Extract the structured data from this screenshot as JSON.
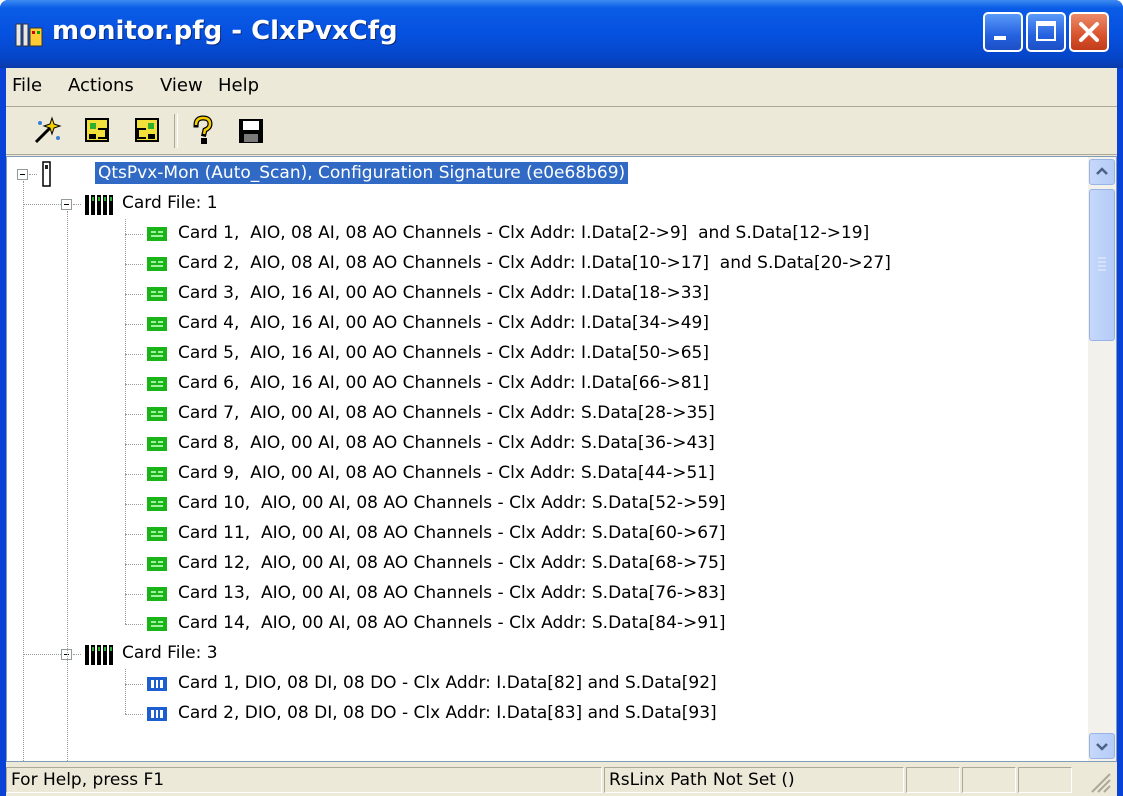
{
  "window": {
    "title": "monitor.pfg - ClxPvxCfg"
  },
  "menu": [
    {
      "label": "File"
    },
    {
      "label": "Actions"
    },
    {
      "label": "View"
    },
    {
      "label": "Help"
    }
  ],
  "toolbar": [
    {
      "name": "wizard-tool-icon"
    },
    {
      "name": "download-tool-icon"
    },
    {
      "name": "upload-tool-icon"
    },
    {
      "name": "help-tool-icon"
    },
    {
      "name": "save-tool-icon"
    }
  ],
  "tree": {
    "root": {
      "label": "QtsPvx-Mon (Auto_Scan), Configuration Signature (e0e68b69)",
      "selected": true
    },
    "card_files": [
      {
        "label": "Card File: 1",
        "cards": [
          {
            "label": "Card 1,  AIO, 08 AI, 08 AO Channels - Clx Addr: I.Data[2->9]  and S.Data[12->19]",
            "type": "aio"
          },
          {
            "label": "Card 2,  AIO, 08 AI, 08 AO Channels - Clx Addr: I.Data[10->17]  and S.Data[20->27]",
            "type": "aio"
          },
          {
            "label": "Card 3,  AIO, 16 AI, 00 AO Channels - Clx Addr: I.Data[18->33]",
            "type": "aio"
          },
          {
            "label": "Card 4,  AIO, 16 AI, 00 AO Channels - Clx Addr: I.Data[34->49]",
            "type": "aio"
          },
          {
            "label": "Card 5,  AIO, 16 AI, 00 AO Channels - Clx Addr: I.Data[50->65]",
            "type": "aio"
          },
          {
            "label": "Card 6,  AIO, 16 AI, 00 AO Channels - Clx Addr: I.Data[66->81]",
            "type": "aio"
          },
          {
            "label": "Card 7,  AIO, 00 AI, 08 AO Channels - Clx Addr: S.Data[28->35]",
            "type": "aio"
          },
          {
            "label": "Card 8,  AIO, 00 AI, 08 AO Channels - Clx Addr: S.Data[36->43]",
            "type": "aio"
          },
          {
            "label": "Card 9,  AIO, 00 AI, 08 AO Channels - Clx Addr: S.Data[44->51]",
            "type": "aio"
          },
          {
            "label": "Card 10,  AIO, 00 AI, 08 AO Channels - Clx Addr: S.Data[52->59]",
            "type": "aio"
          },
          {
            "label": "Card 11,  AIO, 00 AI, 08 AO Channels - Clx Addr: S.Data[60->67]",
            "type": "aio"
          },
          {
            "label": "Card 12,  AIO, 00 AI, 08 AO Channels - Clx Addr: S.Data[68->75]",
            "type": "aio"
          },
          {
            "label": "Card 13,  AIO, 00 AI, 08 AO Channels - Clx Addr: S.Data[76->83]",
            "type": "aio"
          },
          {
            "label": "Card 14,  AIO, 00 AI, 08 AO Channels - Clx Addr: S.Data[84->91]",
            "type": "aio"
          }
        ]
      },
      {
        "label": "Card File: 3",
        "cards": [
          {
            "label": "Card 1, DIO, 08 DI, 08 DO - Clx Addr: I.Data[82] and S.Data[92]",
            "type": "dio"
          },
          {
            "label": "Card 2, DIO, 08 DI, 08 DO - Clx Addr: I.Data[83] and S.Data[93]",
            "type": "dio"
          }
        ]
      }
    ]
  },
  "status": {
    "help": "For Help, press F1",
    "rslinx": "RsLinx Path Not Set ()"
  },
  "colors": {
    "selection": "#316ac5",
    "aio_icon": "#18b418",
    "dio_icon": "#1d5fd0"
  }
}
